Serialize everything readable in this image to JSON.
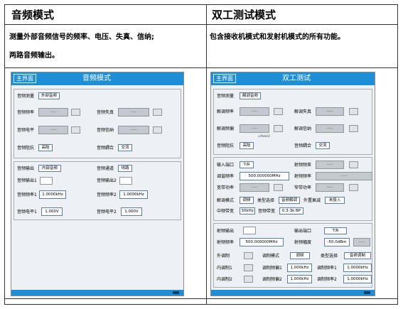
{
  "cells": {
    "left_title": "音频模式",
    "right_title": "双工测试模式",
    "left_desc_line1": "测量外部音频信号的频率、电压、失真、信纳;",
    "left_desc_line2": "两路音频输出。",
    "right_desc": "包含接收机模式和发射机模式的所有功能。"
  },
  "audio_panel": {
    "home": "主界面",
    "title": "音频模式",
    "measure_label": "音频测量",
    "measure_value": "外部音频",
    "freq_label": "音频频率",
    "freq_value": "-----",
    "distortion_label": "音频失真",
    "distortion_value": "-----",
    "level_label": "音频电平",
    "level_value": "-----",
    "sinad_label": "音频信纳",
    "sinad_value": "-----",
    "impedance_label": "音频阻抗",
    "impedance_value": "高阻",
    "coupling_label": "音频耦合",
    "coupling_value": "交流",
    "output_label": "音频输出",
    "output_value": "内部音频",
    "channel_label": "音频通道",
    "channel_value": "线路",
    "out1_label": "音频输出1",
    "out2_label": "音频输出2",
    "f1_label": "音频频率1",
    "f1_value": "1.0000kHz",
    "f2_label": "音频频率2",
    "f2_value": "1.0000kHz",
    "v1_label": "音频电平1",
    "v1_value": "1.000V",
    "v2_label": "音频电平2",
    "v2_value": "1.000V"
  },
  "duplex_panel": {
    "home": "主界面",
    "title": "双工测试",
    "measure_label": "音频测量",
    "measure_value": "解调音频",
    "demod_freq_label": "解调频率",
    "demod_freq_value": "-----",
    "demod_dist_label": "解调失真",
    "demod_dist_value": "-----",
    "demod_dev_label": "解调频偏",
    "demod_dev_value": "-----",
    "peak_note": "±Peak/2",
    "demod_sinad_label": "解调信纳",
    "demod_sinad_value": "-----",
    "impedance_label": "音频阻抗",
    "impedance_value": "高阻",
    "coupling_label": "音频耦合",
    "coupling_value": "交流",
    "input_port_label": "输入端口",
    "input_port_value": "T/R",
    "rf_freq_label": "射频频差",
    "rf_freq_value": "-----",
    "tune_freq_label": "调谐频率",
    "tune_freq_value": "500.000000MHz",
    "rf_fre2_label": "射频频率",
    "rf_fre2_value": "-----",
    "wide_power_label": "宽带功率",
    "wide_power_value": "-----",
    "narrow_power_label": "窄带功率",
    "narrow_power_value": "-----",
    "demod_mode_label": "解调模式",
    "demod_mode_value": "调频",
    "type_sel_label": "类型选择",
    "type_sel_value": "音频解调",
    "ext_atten_label": "外置衰减",
    "ext_atten_value": "未投入",
    "if_bw_label": "中频带宽",
    "if_bw_value": "30kHz",
    "audio_bw_label": "音频带宽",
    "audio_bw_value": "0.3-3k BP",
    "rf_out_label": "射频输出",
    "out_port_label": "输出端口",
    "out_port_value": "T/R",
    "rf_freq3_label": "射频频率",
    "rf_freq3_value": "500.000000MHz",
    "rf_amp_label": "射频幅度",
    "rf_amp_value": "-50.0dBm",
    "rf_amp_extra": "-----",
    "ext_mod_label": "外调制",
    "mod_mode_label": "调制模式",
    "mod_mode_value": "调频",
    "type_sel2_label": "类型选择",
    "type_sel2_value": "音频调制",
    "int_mod1_label": "内调制1",
    "mod_freq1_label": "调制频偏1",
    "mod_freq1_value": "1.000kHz",
    "mod_rate1_label": "调制频率1",
    "mod_rate1_value": "1.0000kHz",
    "int_mod2_label": "内调制2",
    "mod_freq2_label": "调制频偏2",
    "mod_freq2_value": "1.000kHz",
    "mod_rate2_label": "调制频率2",
    "mod_rate2_value": "1.0000kHz"
  }
}
